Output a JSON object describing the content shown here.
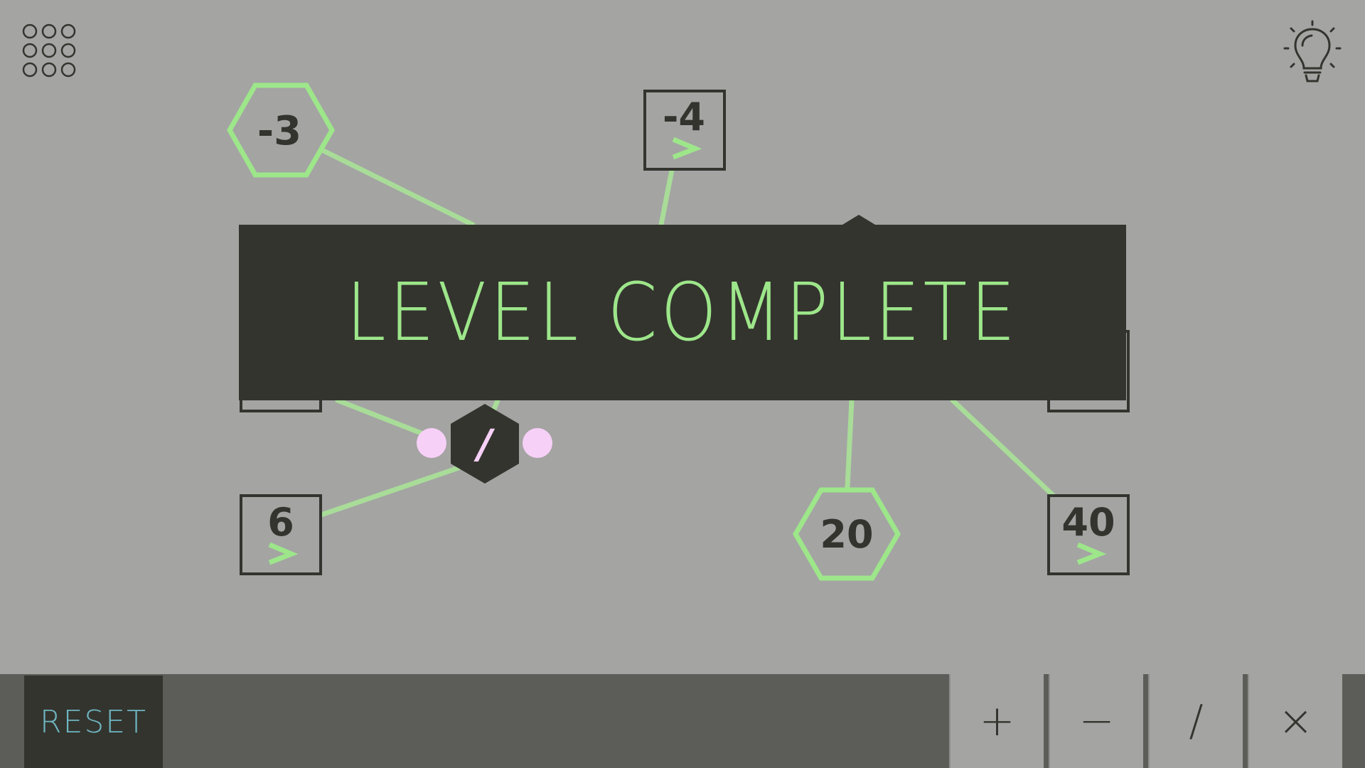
{
  "header": {
    "menu_icon": "grid-menu-icon",
    "hint_icon": "lightbulb-icon"
  },
  "nodes": {
    "hex_minus3": "-3",
    "box_minus4": "-4",
    "hex_20": "20",
    "box_6": "6",
    "box_40": "40",
    "operator_divide": "/"
  },
  "banner": {
    "text": "LEVEL COMPLETE"
  },
  "toolbar": {
    "reset_label": "RESET",
    "ops": [
      "+",
      "−",
      "/",
      "×"
    ]
  },
  "colors": {
    "background": "#a4a4a3",
    "dark": "#33342e",
    "accent_green": "#9de68a",
    "pink_dot": "#f7d0f7",
    "reset_text": "#6fb6c2",
    "bottom_bar": "#5c5d58"
  }
}
